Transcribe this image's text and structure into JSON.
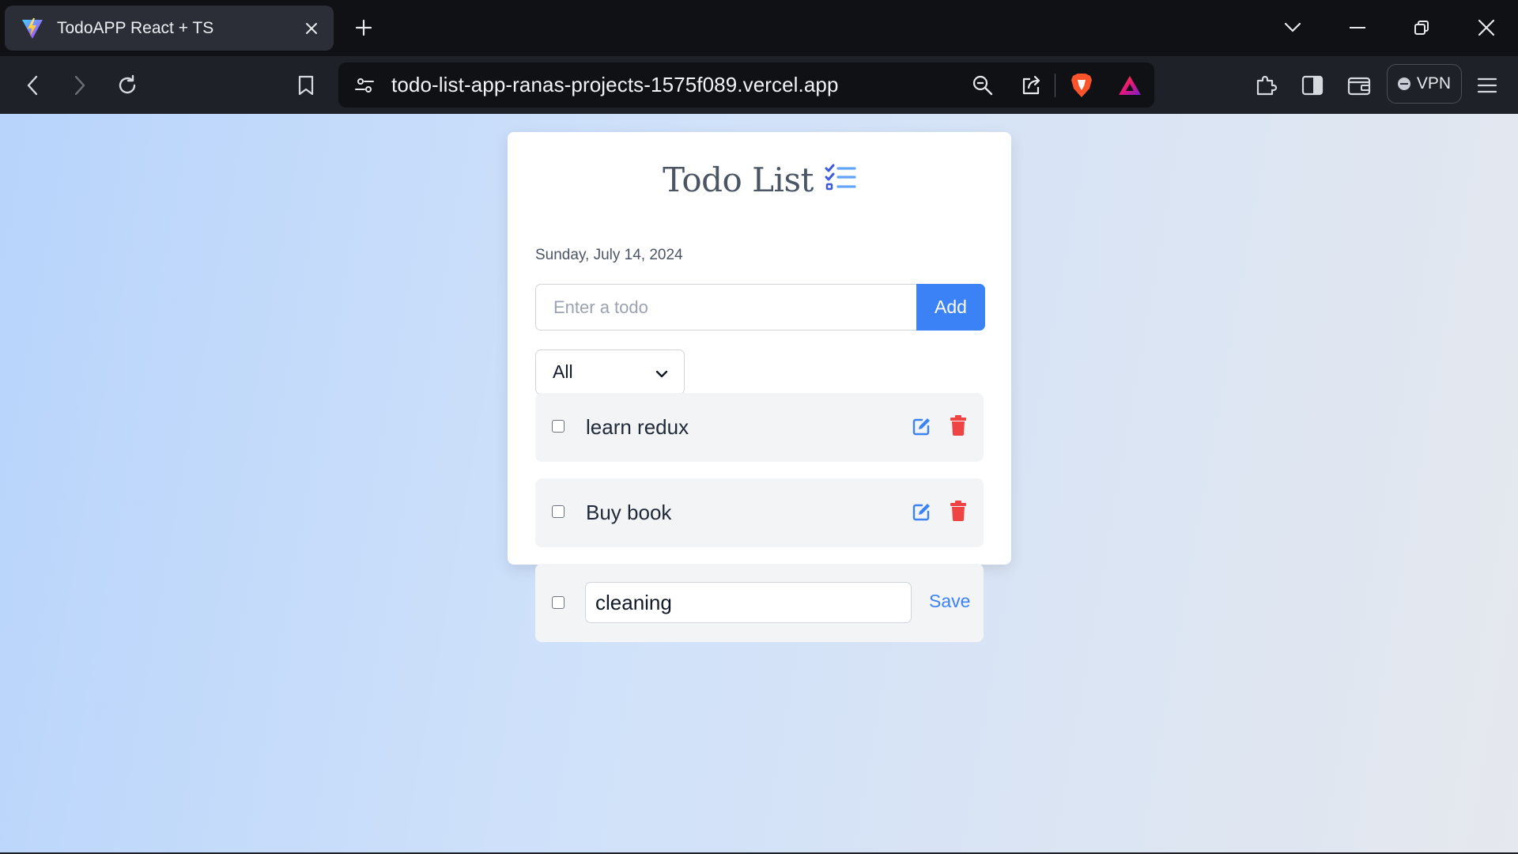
{
  "browser": {
    "tab": {
      "title": "TodoAPP React + TS"
    },
    "address_bar": {
      "url": "todo-list-app-ranas-projects-1575f089.vercel.app"
    },
    "vpn_label": "VPN",
    "icons": [
      "vite-favicon-icon",
      "close-icon",
      "plus-icon",
      "chevron-down-icon",
      "minimize-icon",
      "restore-icon",
      "close-window-icon",
      "back-icon",
      "forward-icon",
      "reload-icon",
      "bookmark-icon",
      "site-settings-icon",
      "zoom-icon",
      "share-icon",
      "brave-shields-icon",
      "brave-rewards-icon",
      "extensions-icon",
      "sidebar-icon",
      "wallet-icon",
      "menu-icon"
    ]
  },
  "app": {
    "title": "Todo List",
    "title_icon": "list-check-icon",
    "date": "Sunday, July 14, 2024",
    "input": {
      "placeholder": "Enter a todo",
      "value": ""
    },
    "add_button": "Add",
    "filter": {
      "selected": "All"
    },
    "todos": [
      {
        "text": "learn redux",
        "completed": false,
        "editing": false
      },
      {
        "text": "Buy book",
        "completed": false,
        "editing": false
      },
      {
        "text": "cleaning",
        "completed": false,
        "editing": true,
        "save_label": "Save"
      }
    ],
    "colors": {
      "accent": "#3b82f6",
      "delete": "#ef4444",
      "item_bg": "#f3f4f6"
    }
  }
}
